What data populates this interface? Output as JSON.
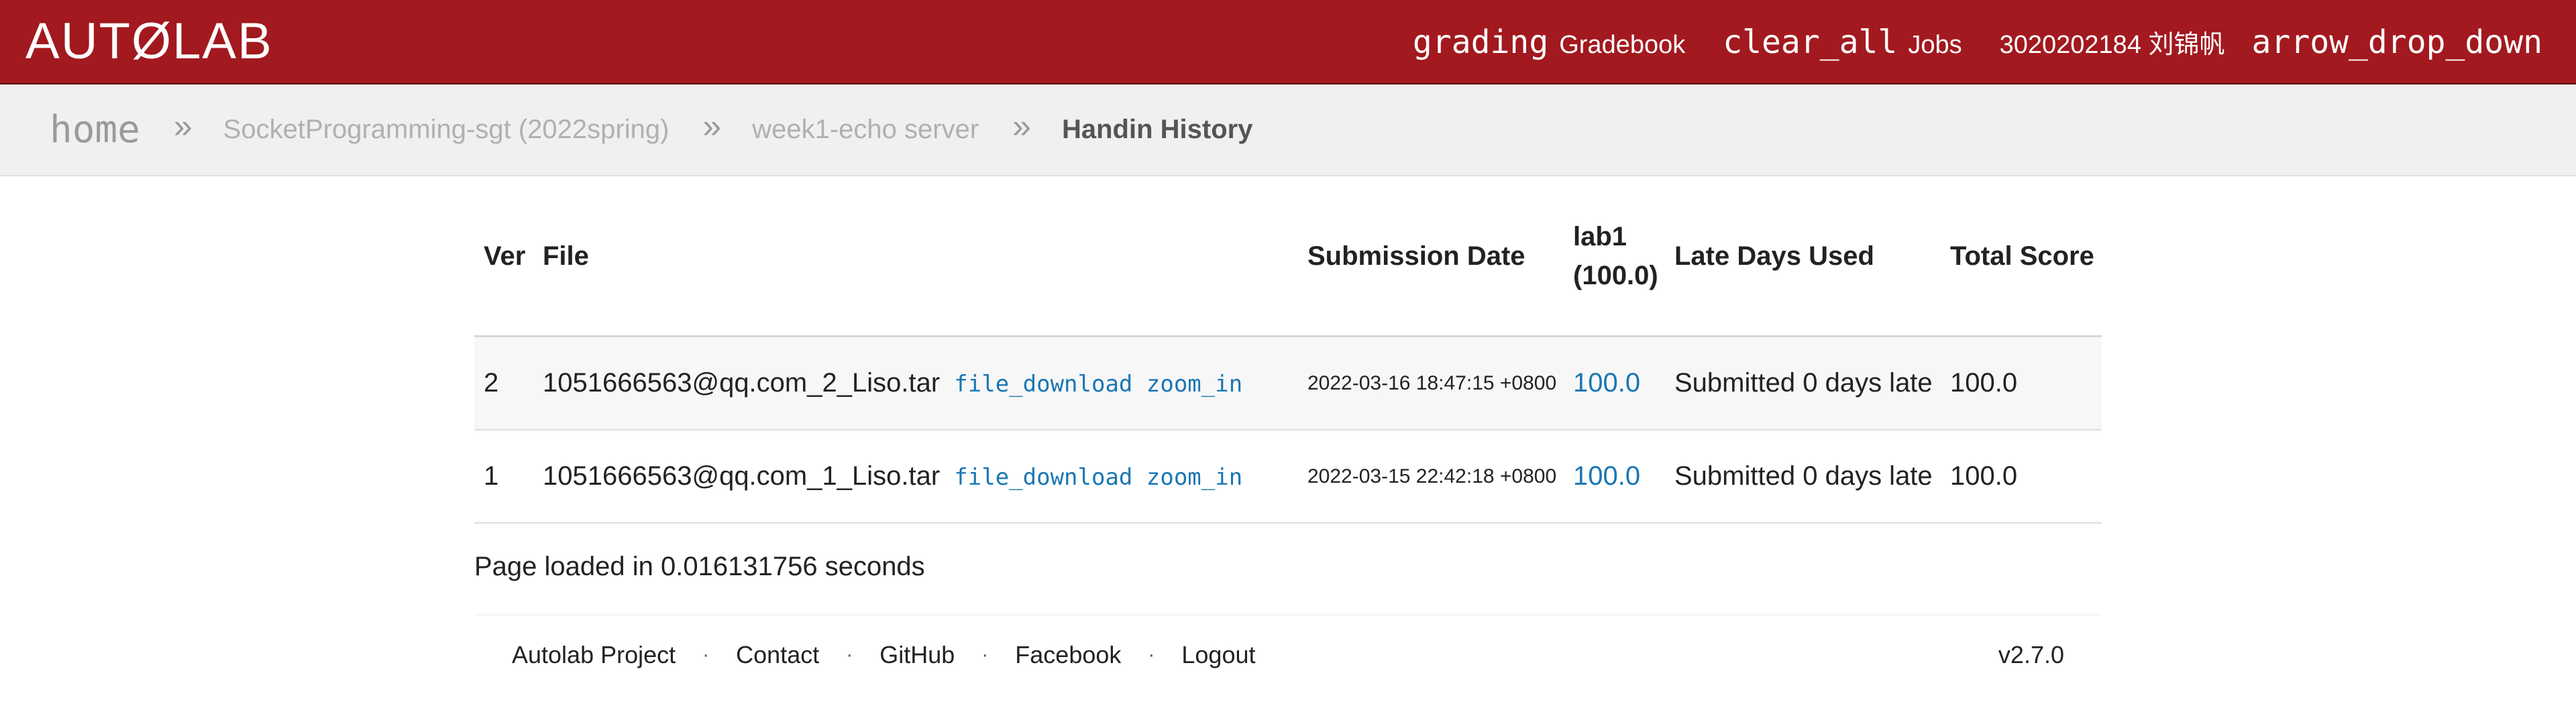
{
  "header": {
    "brand": "AUTØLAB",
    "gradebook_icon": "grading",
    "gradebook_label": "Gradebook",
    "jobs_icon": "clear_all",
    "jobs_label": "Jobs",
    "user": "3020202184 刘锦帆",
    "dropdown_icon": "arrow_drop_down"
  },
  "breadcrumb": {
    "home": "home",
    "separator": "»",
    "course": "SocketProgramming-sgt (2022spring)",
    "assignment": "week1-echo server",
    "current": "Handin History"
  },
  "table": {
    "headers": {
      "ver": "Ver",
      "file": "File",
      "date": "Submission Date",
      "lab_line1": "lab1",
      "lab_line2": "(100.0)",
      "late": "Late Days Used",
      "total": "Total Score"
    },
    "download_icon": "file_download",
    "view_icon": "zoom_in",
    "rows": [
      {
        "ver": "2",
        "file": "1051666563@qq.com_2_Liso.tar",
        "date": "2022-03-16 18:47:15 +0800",
        "lab1": "100.0",
        "late": "Submitted 0 days late",
        "total": "100.0"
      },
      {
        "ver": "1",
        "file": "1051666563@qq.com_1_Liso.tar",
        "date": "2022-03-15 22:42:18 +0800",
        "lab1": "100.0",
        "late": "Submitted 0 days late",
        "total": "100.0"
      }
    ]
  },
  "page_loaded": "Page loaded in 0.016131756 seconds",
  "footer": {
    "links": [
      "Autolab Project",
      "Contact",
      "GitHub",
      "Facebook",
      "Logout"
    ],
    "separator": "·",
    "version": "v2.7.0"
  },
  "colors": {
    "header_bg": "#a2191f",
    "link_blue": "#1976b4",
    "breadcrumb_bg": "#f1f0ef"
  }
}
